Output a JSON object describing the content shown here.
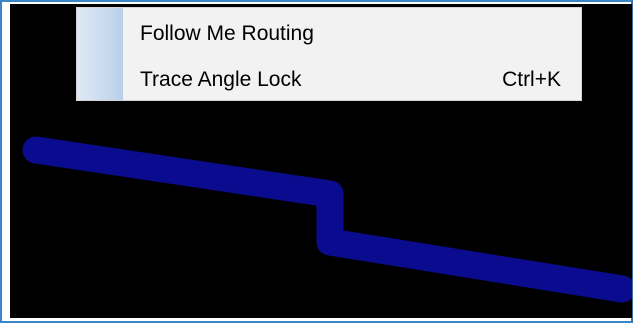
{
  "context_menu": {
    "items": [
      {
        "label": "Follow Me Routing",
        "shortcut": ""
      },
      {
        "label": "Trace Angle Lock",
        "shortcut": "Ctrl+K"
      }
    ]
  },
  "canvas": {
    "background": "#000000",
    "trace_color": "#0b0b8f"
  }
}
